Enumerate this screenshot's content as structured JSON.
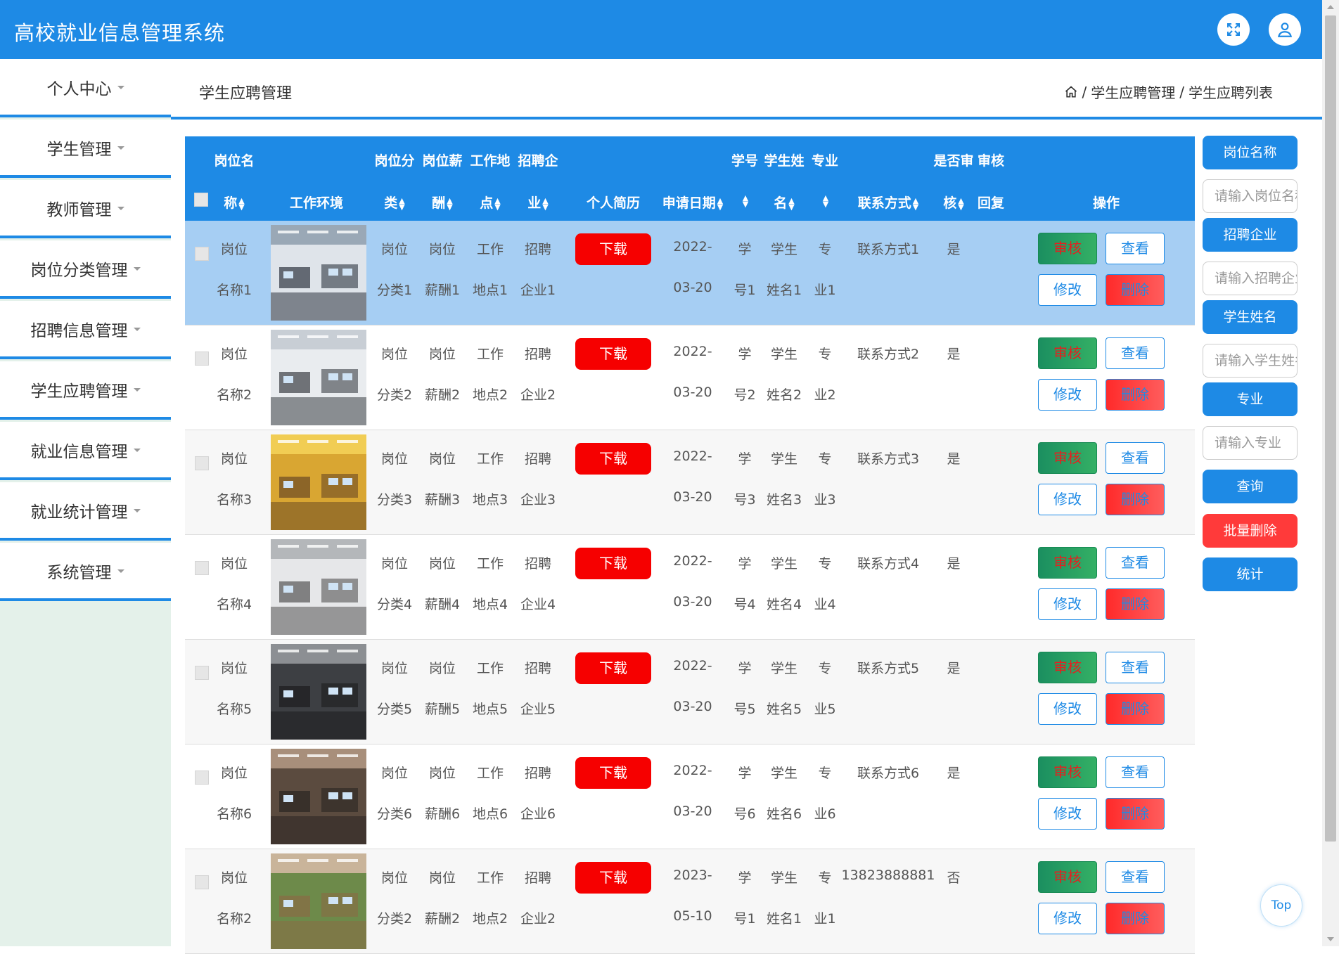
{
  "app": {
    "title": "高校就业信息管理系统"
  },
  "sidebar": {
    "items": [
      {
        "label": "个人中心"
      },
      {
        "label": "学生管理"
      },
      {
        "label": "教师管理"
      },
      {
        "label": "岗位分类管理"
      },
      {
        "label": "招聘信息管理"
      },
      {
        "label": "学生应聘管理"
      },
      {
        "label": "就业信息管理"
      },
      {
        "label": "就业统计管理"
      },
      {
        "label": "系统管理"
      }
    ]
  },
  "page": {
    "title": "学生应聘管理",
    "breadcrumb": [
      "学生应聘管理",
      "学生应聘列表"
    ],
    "separator": "/"
  },
  "table": {
    "headers": {
      "name_1": "岗位名",
      "name_2": "称",
      "env": "工作环境",
      "cat_1": "岗位分",
      "cat_2": "类",
      "salary_1": "岗位薪",
      "salary_2": "酬",
      "place_1": "工作地",
      "place_2": "点",
      "company_1": "招聘企",
      "company_2": "业",
      "resume": "个人简历",
      "date": "申请日期",
      "sno": "学号",
      "sname_1": "学生姓",
      "sname_2": "名",
      "major": "专业",
      "contact": "联系方式",
      "audit_1": "是否审",
      "audit_2": "核",
      "reply_1": "审核",
      "reply_2": "回复",
      "ops": "操作"
    },
    "rows": [
      {
        "name_1": "岗位",
        "name_2": "名称1",
        "cat_1": "岗位",
        "cat_2": "分类1",
        "sal_1": "岗位",
        "sal_2": "薪酬1",
        "pl_1": "工作",
        "pl_2": "地点1",
        "co_1": "招聘",
        "co_2": "企业1",
        "date_1": "2022-",
        "date_2": "03-20",
        "sno_1": "学",
        "sno_2": "号1",
        "sn_1": "学生",
        "sn_2": "姓名1",
        "mj_1": "专",
        "mj_2": "业1",
        "contact": "联系方式1",
        "audit": "是"
      },
      {
        "name_1": "岗位",
        "name_2": "名称2",
        "cat_1": "岗位",
        "cat_2": "分类2",
        "sal_1": "岗位",
        "sal_2": "薪酬2",
        "pl_1": "工作",
        "pl_2": "地点2",
        "co_1": "招聘",
        "co_2": "企业2",
        "date_1": "2022-",
        "date_2": "03-20",
        "sno_1": "学",
        "sno_2": "号2",
        "sn_1": "学生",
        "sn_2": "姓名2",
        "mj_1": "专",
        "mj_2": "业2",
        "contact": "联系方式2",
        "audit": "是"
      },
      {
        "name_1": "岗位",
        "name_2": "名称3",
        "cat_1": "岗位",
        "cat_2": "分类3",
        "sal_1": "岗位",
        "sal_2": "薪酬3",
        "pl_1": "工作",
        "pl_2": "地点3",
        "co_1": "招聘",
        "co_2": "企业3",
        "date_1": "2022-",
        "date_2": "03-20",
        "sno_1": "学",
        "sno_2": "号3",
        "sn_1": "学生",
        "sn_2": "姓名3",
        "mj_1": "专",
        "mj_2": "业3",
        "contact": "联系方式3",
        "audit": "是"
      },
      {
        "name_1": "岗位",
        "name_2": "名称4",
        "cat_1": "岗位",
        "cat_2": "分类4",
        "sal_1": "岗位",
        "sal_2": "薪酬4",
        "pl_1": "工作",
        "pl_2": "地点4",
        "co_1": "招聘",
        "co_2": "企业4",
        "date_1": "2022-",
        "date_2": "03-20",
        "sno_1": "学",
        "sno_2": "号4",
        "sn_1": "学生",
        "sn_2": "姓名4",
        "mj_1": "专",
        "mj_2": "业4",
        "contact": "联系方式4",
        "audit": "是"
      },
      {
        "name_1": "岗位",
        "name_2": "名称5",
        "cat_1": "岗位",
        "cat_2": "分类5",
        "sal_1": "岗位",
        "sal_2": "薪酬5",
        "pl_1": "工作",
        "pl_2": "地点5",
        "co_1": "招聘",
        "co_2": "企业5",
        "date_1": "2022-",
        "date_2": "03-20",
        "sno_1": "学",
        "sno_2": "号5",
        "sn_1": "学生",
        "sn_2": "姓名5",
        "mj_1": "专",
        "mj_2": "业5",
        "contact": "联系方式5",
        "audit": "是"
      },
      {
        "name_1": "岗位",
        "name_2": "名称6",
        "cat_1": "岗位",
        "cat_2": "分类6",
        "sal_1": "岗位",
        "sal_2": "薪酬6",
        "pl_1": "工作",
        "pl_2": "地点6",
        "co_1": "招聘",
        "co_2": "企业6",
        "date_1": "2022-",
        "date_2": "03-20",
        "sno_1": "学",
        "sno_2": "号6",
        "sn_1": "学生",
        "sn_2": "姓名6",
        "mj_1": "专",
        "mj_2": "业6",
        "contact": "联系方式6",
        "audit": "是"
      },
      {
        "name_1": "岗位",
        "name_2": "名称2",
        "cat_1": "岗位",
        "cat_2": "分类2",
        "sal_1": "岗位",
        "sal_2": "薪酬2",
        "pl_1": "工作",
        "pl_2": "地点2",
        "co_1": "招聘",
        "co_2": "企业2",
        "date_1": "2023-",
        "date_2": "05-10",
        "sno_1": "学",
        "sno_2": "号1",
        "sn_1": "学生",
        "sn_2": "姓名1",
        "mj_1": "专",
        "mj_2": "业1",
        "contact": "13823888881",
        "audit": "否"
      }
    ],
    "buttons": {
      "download": "下载",
      "audit": "审核",
      "view": "查看",
      "edit": "修改",
      "delete": "删除"
    }
  },
  "search": {
    "job_name_label": "岗位名称",
    "job_name_placeholder": "请输入岗位名称",
    "company_label": "招聘企业",
    "company_placeholder": "请输入招聘企业",
    "student_label": "学生姓名",
    "student_placeholder": "请输入学生姓名",
    "major_label": "专业",
    "major_placeholder": "请输入专业",
    "query": "查询",
    "batch_delete": "批量删除",
    "stats": "统计"
  },
  "totop": "Top",
  "colors": {
    "primary": "#1e8ae5",
    "download": "#f60000",
    "danger": "#ff3a3a",
    "audit": "#1b8f60",
    "selected_row": "#a6cef3"
  }
}
